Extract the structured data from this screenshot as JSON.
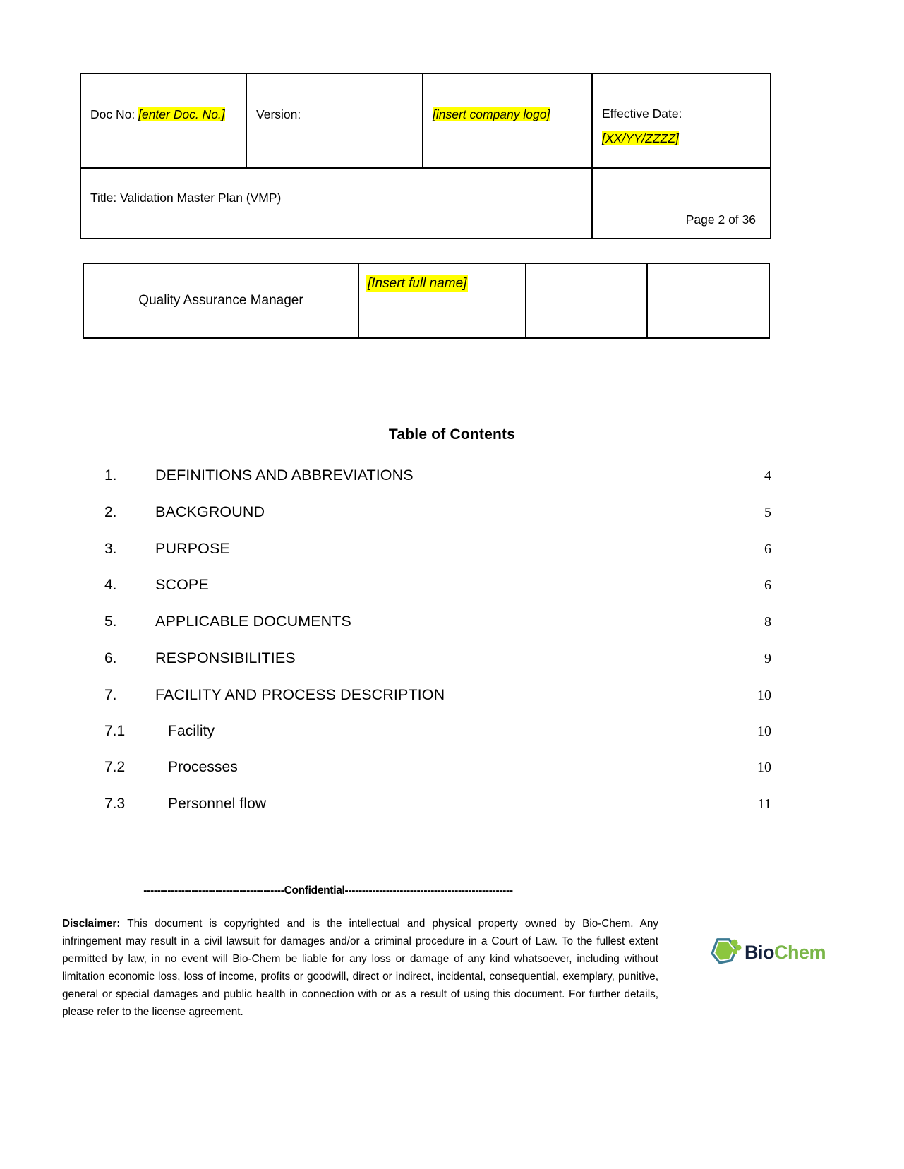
{
  "header": {
    "doc_no_label": "Doc No:",
    "doc_no_value": "[enter Doc. No.]",
    "version_label": "Version:",
    "logo_placeholder": "[insert company logo]",
    "effective_date_label": "Effective Date:",
    "effective_date_value": "[XX/YY/ZZZZ]",
    "title_label": "Title: Validation Master Plan (VMP)",
    "page_label": "Page 2 of 36"
  },
  "signature_table": {
    "role": "Quality Assurance Manager",
    "name_placeholder": "[Insert full name]",
    "empty_cell_1": "",
    "empty_cell_2": ""
  },
  "toc": {
    "title": "Table of Contents",
    "entries": [
      {
        "num": "1.",
        "label": "DEFINITIONS AND ABBREVIATIONS",
        "page": "4",
        "level": "main"
      },
      {
        "num": "2.",
        "label": "BACKGROUND",
        "page": "5",
        "level": "main"
      },
      {
        "num": "3.",
        "label": "PURPOSE",
        "page": "6",
        "level": "main"
      },
      {
        "num": "4.",
        "label": "SCOPE",
        "page": "6",
        "level": "main"
      },
      {
        "num": "5.",
        "label": "APPLICABLE DOCUMENTS",
        "page": "8",
        "level": "main"
      },
      {
        "num": "6.",
        "label": "RESPONSIBILITIES",
        "page": "9",
        "level": "main"
      },
      {
        "num": "7.",
        "label": "FACILITY AND PROCESS DESCRIPTION",
        "page": "10",
        "level": "main"
      },
      {
        "num": "7.1",
        "label": "Facility",
        "page": "10",
        "level": "sub"
      },
      {
        "num": "7.2",
        "label": "Processes",
        "page": "10",
        "level": "sub"
      },
      {
        "num": "7.3",
        "label": "Personnel flow",
        "page": "11",
        "level": "sub"
      }
    ]
  },
  "footer": {
    "confidential": "-----------------------------------------Confidential-------------------------------------------------",
    "disclaimer_label": "Disclaimer:",
    "disclaimer_text": " This document is copyrighted and is the intellectual and physical property owned by Bio-Chem. Any infringement may result in a civil lawsuit for damages and/or a criminal procedure in a Court of Law. To the fullest extent permitted by law, in no event will Bio-Chem be liable for any loss or damage of any kind whatsoever, including without limitation economic loss, loss of income, profits or goodwill, direct or indirect, incidental, consequential, exemplary, punitive, general or special damages and public health in connection with or as a result of using this document. For further details, please refer to the license agreement.",
    "logo_bio": "Bio",
    "logo_chem": "Chem"
  },
  "colors": {
    "highlight": "#ffff00",
    "logo_hex_outline": "#3d7b93",
    "logo_hex_fill": "#8cc63f",
    "logo_bio_text": "#14213d",
    "logo_chem_text": "#7ab648"
  }
}
